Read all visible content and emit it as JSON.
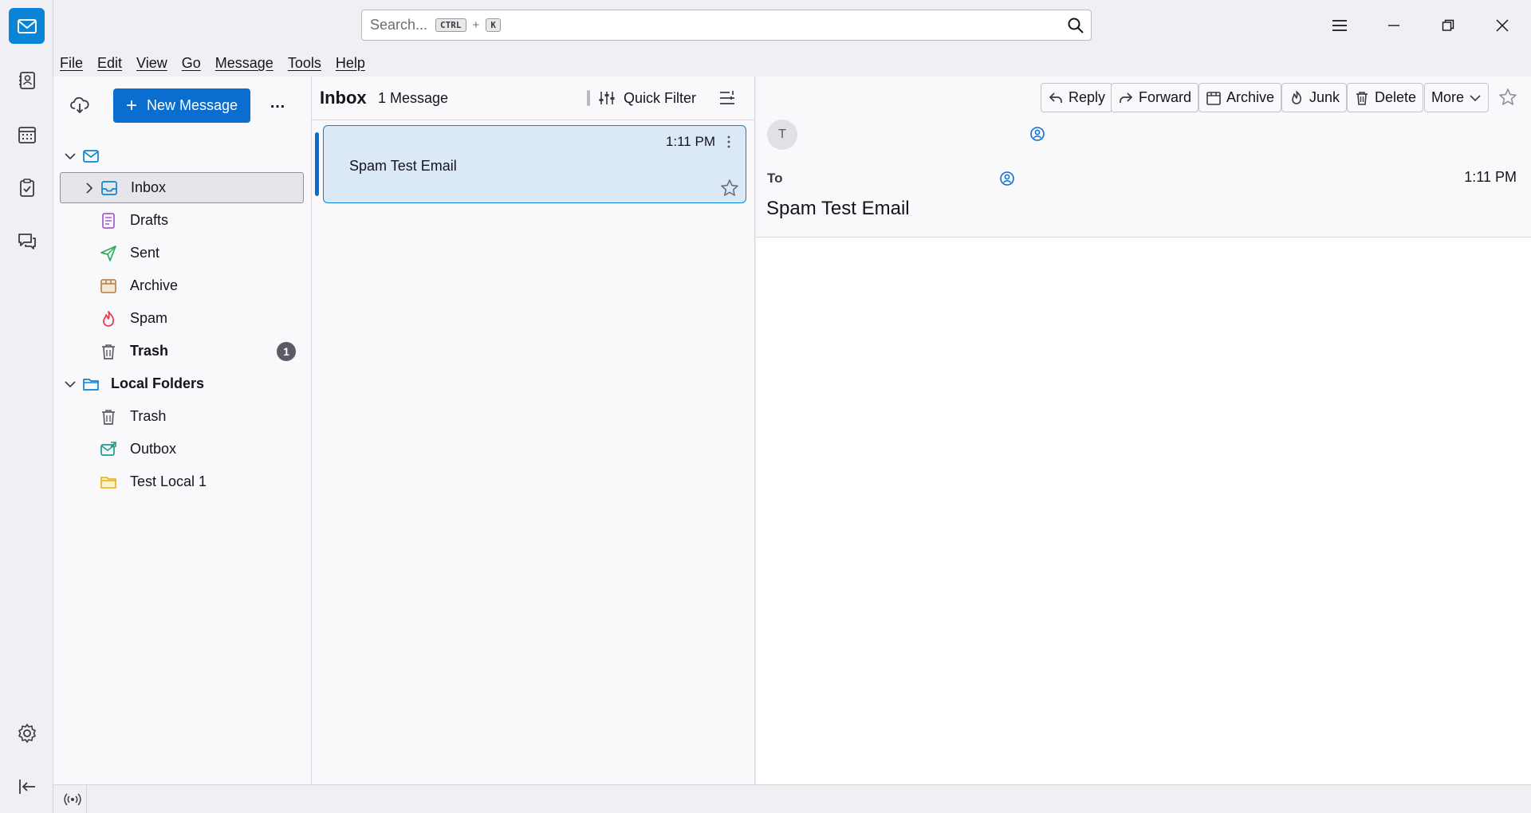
{
  "colors": {
    "accent": "#0a6ed1",
    "selected_bg": "#dbe9f7",
    "badge": "#5b5b66"
  },
  "spaces": [
    {
      "name": "mail-icon"
    },
    {
      "name": "address-book-icon"
    },
    {
      "name": "calendar-icon"
    },
    {
      "name": "tasks-icon"
    },
    {
      "name": "chat-icon"
    },
    {
      "name": "settings-icon"
    },
    {
      "name": "collapse-spaces-icon"
    }
  ],
  "search": {
    "placeholder": "Search...",
    "key1": "CTRL",
    "plus": "+",
    "key2": "K"
  },
  "menu": [
    "File",
    "Edit",
    "View",
    "Go",
    "Message",
    "Tools",
    "Help"
  ],
  "folder_pane": {
    "new_message": "New Message",
    "more": "…",
    "folders": {
      "inbox": "Inbox",
      "drafts": "Drafts",
      "sent": "Sent",
      "archive": "Archive",
      "spam": "Spam",
      "trash": "Trash",
      "trash_count": "1",
      "local_folders": "Local Folders",
      "local_trash": "Trash",
      "outbox": "Outbox",
      "test_local": "Test Local 1"
    }
  },
  "thread_pane": {
    "title": "Inbox",
    "count": "1 Message",
    "quick_filter": "Quick Filter",
    "messages": [
      {
        "time": "1:11 PM",
        "subject": "Spam Test Email"
      }
    ]
  },
  "message_pane": {
    "buttons": {
      "reply": "Reply",
      "forward": "Forward",
      "archive": "Archive",
      "junk": "Junk",
      "delete": "Delete",
      "more": "More"
    },
    "avatar_letter": "T",
    "to_label": "To",
    "time": "1:11 PM",
    "subject": "Spam Test Email"
  }
}
